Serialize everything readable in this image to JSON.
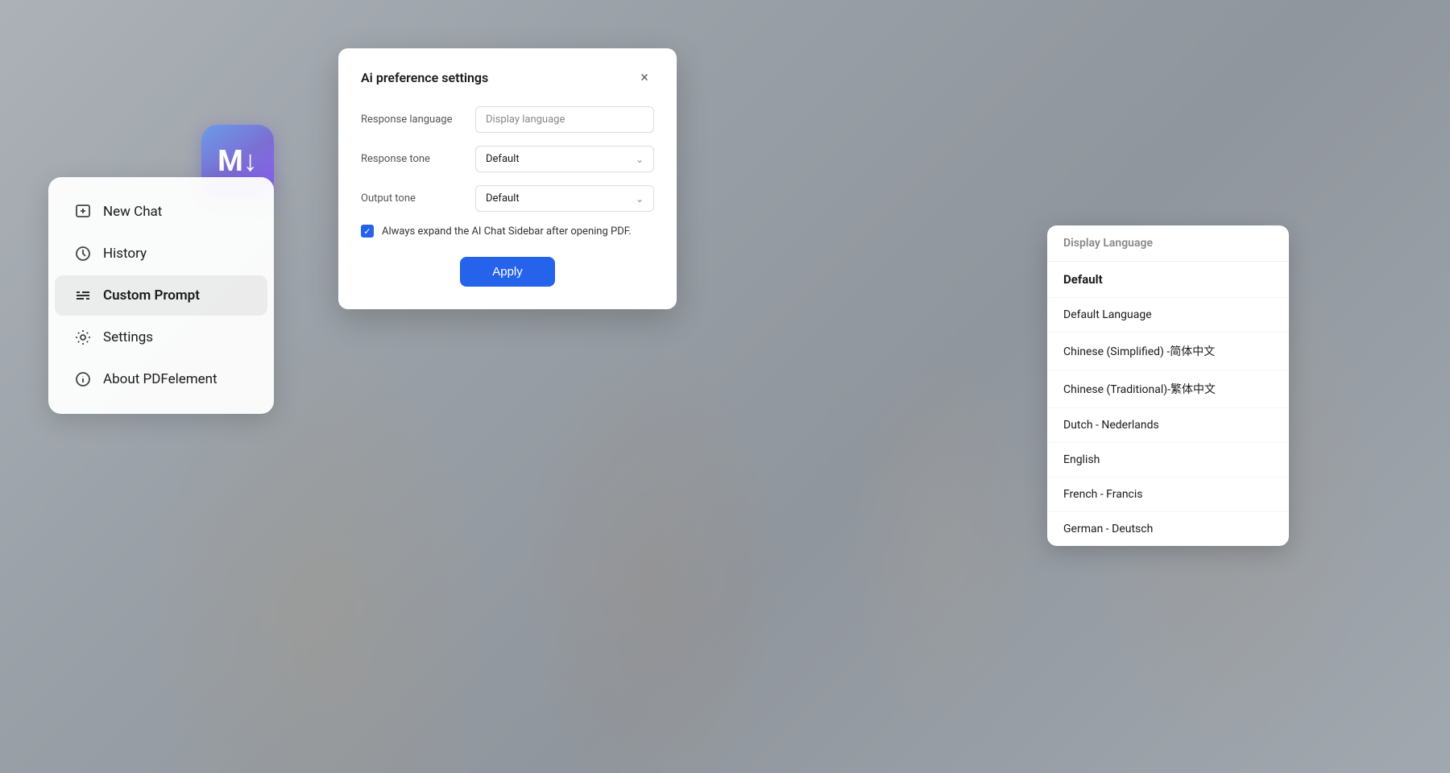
{
  "app": {
    "logo_letter": "M↓"
  },
  "sidebar": {
    "items": [
      {
        "id": "new-chat",
        "label": "New Chat",
        "icon": "new-chat-icon"
      },
      {
        "id": "history",
        "label": "History",
        "icon": "history-icon"
      },
      {
        "id": "custom-prompt",
        "label": "Custom Prompt",
        "icon": "custom-prompt-icon",
        "active": true
      },
      {
        "id": "settings",
        "label": "Settings",
        "icon": "settings-icon"
      },
      {
        "id": "about",
        "label": "About PDFelement",
        "icon": "info-icon"
      }
    ]
  },
  "settings_dialog": {
    "title": "Ai preference settings",
    "close_label": "×",
    "fields": [
      {
        "label": "Response language",
        "type": "text",
        "value": "Display language"
      },
      {
        "label": "Response tone",
        "type": "select",
        "value": "Default"
      },
      {
        "label": "Output tone",
        "type": "select",
        "value": "Default"
      }
    ],
    "checkbox_label": "Always expand the AI Chat Sidebar after opening PDF.",
    "apply_button": "Apply"
  },
  "language_dropdown": {
    "header": "Display Language",
    "items": [
      {
        "label": "Default",
        "bold": true
      },
      {
        "label": "Default Language",
        "bold": false
      },
      {
        "label": "Chinese (Simplified) -简体中文",
        "bold": false
      },
      {
        "label": "Chinese (Traditional)-繁体中文",
        "bold": false
      },
      {
        "label": "Dutch - Nederlands",
        "bold": false
      },
      {
        "label": "English",
        "bold": false
      },
      {
        "label": "French - Francis",
        "bold": false
      },
      {
        "label": "German - Deutsch",
        "bold": false
      }
    ]
  }
}
